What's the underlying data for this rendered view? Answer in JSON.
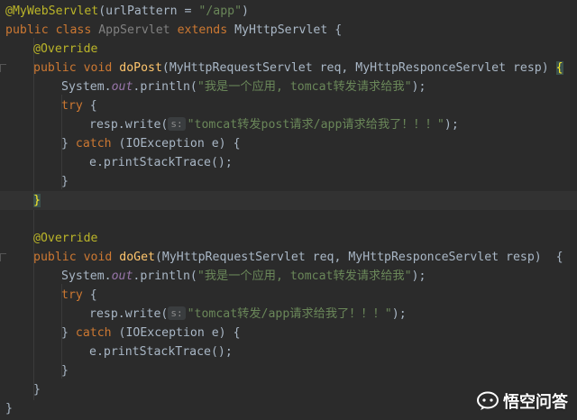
{
  "code": {
    "l1": {
      "annotation": "@MyWebServlet",
      "open": "(urlPattern = ",
      "value": "\"/app\"",
      "close": ")"
    },
    "l2": {
      "kw": "public class ",
      "name": "AppServlet",
      "kw2": " extends ",
      "parent": "MyHttpServlet {"
    },
    "l3": {
      "annotation": "@Override"
    },
    "l4": {
      "kw": "public void ",
      "method": "doPost",
      "params": "(MyHttpRequestServlet req, MyHttpResponceServlet resp) ",
      "brace": "{"
    },
    "l5": {
      "obj": "System.",
      "field": "out",
      "call": ".println(",
      "str": "\"我是一个应用, tomcat转发请求给我\"",
      "end": ");"
    },
    "l6": {
      "kw": "try",
      "rest": " {"
    },
    "l7": {
      "call": "resp.write(",
      "hint": "s:",
      "str": "\"tomcat转发post请求/app请求给我了！！！\"",
      "end": ");"
    },
    "l8": {
      "pre": "} ",
      "kw": "catch",
      "rest": " (IOException e) {"
    },
    "l9": {
      "text": "e.printStackTrace();"
    },
    "l10": {
      "text": "}"
    },
    "l11": {
      "brace": "}"
    },
    "l12": {
      "annotation": "@Override"
    },
    "l13": {
      "kw": "public void ",
      "method": "doGet",
      "params": "(MyHttpRequestServlet req, MyHttpResponceServlet resp)  {"
    },
    "l14": {
      "obj": "System.",
      "field": "out",
      "call": ".println(",
      "str": "\"我是一个应用, tomcat转发请求给我\"",
      "end": ");"
    },
    "l15": {
      "kw": "try",
      "rest": " {"
    },
    "l16": {
      "call": "resp.write(",
      "hint": "s:",
      "str": "\"tomcat转发/app请求给我了！！！\"",
      "end": ");"
    },
    "l17": {
      "pre": "} ",
      "kw": "catch",
      "rest": " (IOException e) {"
    },
    "l18": {
      "text": "e.printStackTrace();"
    },
    "l19": {
      "text": "}"
    },
    "l20": {
      "text": "}"
    },
    "l21": {
      "text": "}"
    }
  },
  "watermark": {
    "text": "悟空问答"
  },
  "colors": {
    "background": "#2b2b2b",
    "keyword": "#cc7832",
    "annotation": "#bbb529",
    "string": "#6a8759",
    "method": "#ffc66d",
    "text": "#a9b7c6"
  }
}
